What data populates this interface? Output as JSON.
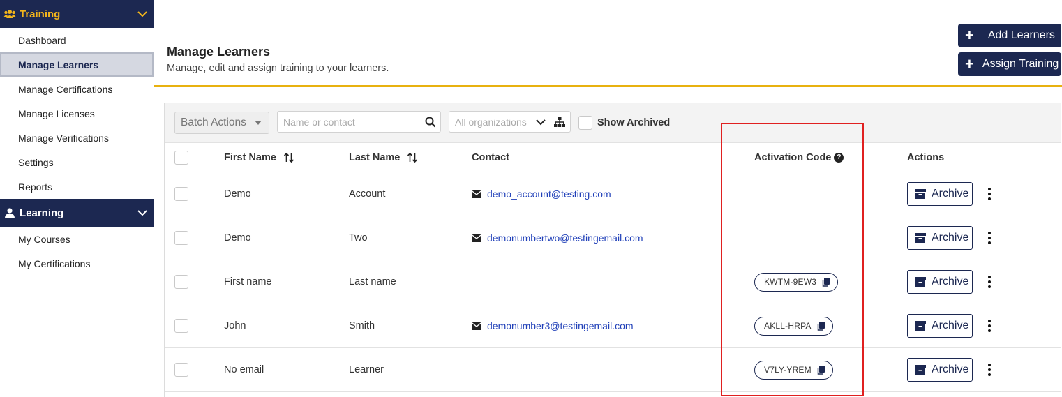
{
  "sidebar": {
    "training_label": "Training",
    "learning_label": "Learning",
    "training_items": [
      {
        "label": "Dashboard"
      },
      {
        "label": "Manage Learners"
      },
      {
        "label": "Manage Certifications"
      },
      {
        "label": "Manage Licenses"
      },
      {
        "label": "Manage Verifications"
      },
      {
        "label": "Settings"
      },
      {
        "label": "Reports"
      }
    ],
    "learning_items": [
      {
        "label": "My Courses"
      },
      {
        "label": "My Certifications"
      }
    ],
    "active_item": "Manage Learners",
    "training_color": "#f2b51c",
    "header_bg": "#1c2851"
  },
  "header": {
    "title": "Manage Learners",
    "subtitle": "Manage, edit and assign training to your learners.",
    "add_learners_label": "Add Learners",
    "assign_training_label": "Assign Training",
    "accent_color": "#e8b10f"
  },
  "toolbar": {
    "batch_actions_label": "Batch Actions",
    "search_placeholder": "Name or contact",
    "search_value": "",
    "org_placeholder": "All organizations",
    "show_archived_label": "Show Archived"
  },
  "table": {
    "columns": {
      "first_name": "First Name",
      "last_name": "Last Name",
      "contact": "Contact",
      "activation_code": "Activation Code",
      "actions": "Actions"
    },
    "archive_label": "Archive",
    "rows": [
      {
        "first": "Demo",
        "last": "Account",
        "email": "demo_account@testing.com",
        "code": ""
      },
      {
        "first": "Demo",
        "last": "Two",
        "email": "demonumbertwo@testingemail.com",
        "code": ""
      },
      {
        "first": "First name",
        "last": "Last name",
        "email": "",
        "code": "KWTM-9EW3"
      },
      {
        "first": "John",
        "last": "Smith",
        "email": "demonumber3@testingemail.com",
        "code": "AKLL-HRPA"
      },
      {
        "first": "No email",
        "last": "Learner",
        "email": "",
        "code": "V7LY-YREM"
      }
    ]
  },
  "highlight_color": "#e02020"
}
